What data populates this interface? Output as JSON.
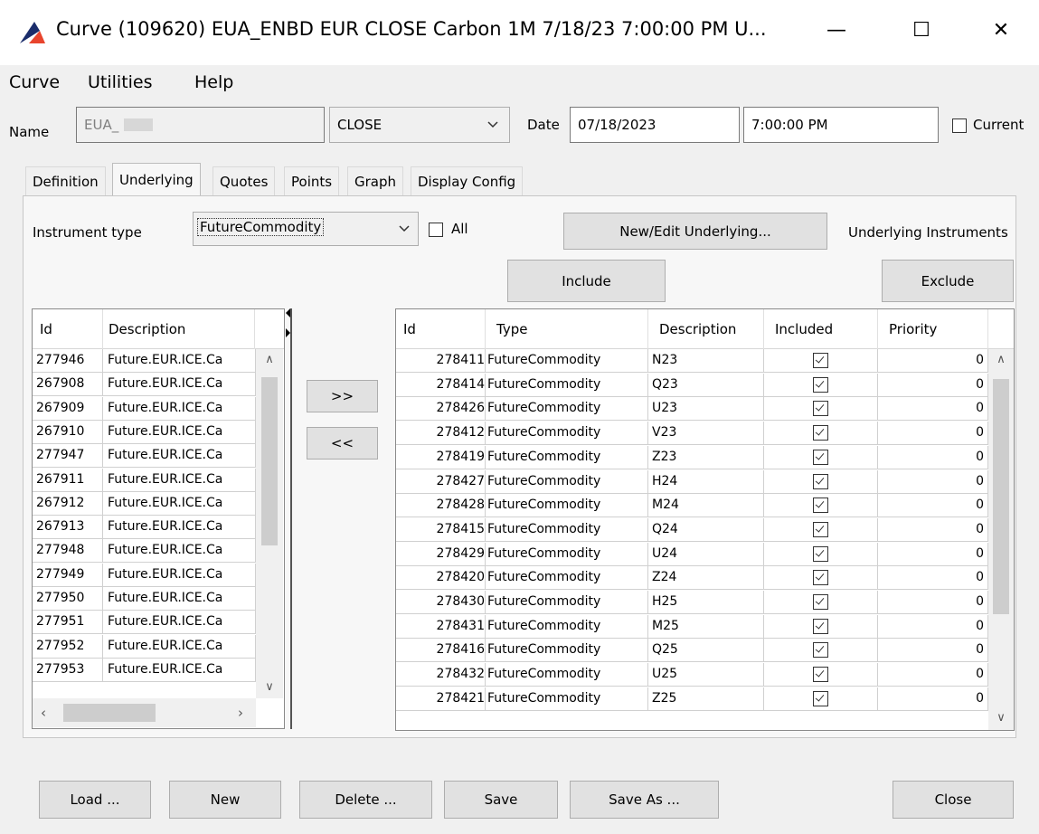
{
  "window": {
    "title": "Curve (109620) EUA_ENBD EUR CLOSE Carbon 1M 7/18/23 7:00:00 PM U...",
    "minimize": "—",
    "maximize": "☐",
    "close": "✕"
  },
  "menu": [
    "Curve",
    "Utilities",
    "Help"
  ],
  "header": {
    "name_label": "Name",
    "name_value": "EUA_",
    "price_type": "CLOSE",
    "date_label": "Date",
    "date_value": "07/18/2023",
    "time_value": "7:00:00 PM",
    "current_label": "Current"
  },
  "tabs": [
    "Definition",
    "Underlying",
    "Quotes",
    "Points",
    "Graph",
    "Display Config"
  ],
  "underlying": {
    "instrument_type_label": "Instrument type",
    "instrument_type_value": "FutureCommodity",
    "all_label": "All",
    "new_edit_button": "New/Edit Underlying...",
    "underlying_instruments_label": "Underlying Instruments",
    "include_button": "Include",
    "exclude_button": "Exclude",
    "move_right": ">>",
    "move_left": "<<"
  },
  "left_table": {
    "columns": [
      "Id",
      "Description"
    ],
    "rows": [
      [
        "277946",
        "Future.EUR.ICE.Ca"
      ],
      [
        "267908",
        "Future.EUR.ICE.Ca"
      ],
      [
        "267909",
        "Future.EUR.ICE.Ca"
      ],
      [
        "267910",
        "Future.EUR.ICE.Ca"
      ],
      [
        "277947",
        "Future.EUR.ICE.Ca"
      ],
      [
        "267911",
        "Future.EUR.ICE.Ca"
      ],
      [
        "267912",
        "Future.EUR.ICE.Ca"
      ],
      [
        "267913",
        "Future.EUR.ICE.Ca"
      ],
      [
        "277948",
        "Future.EUR.ICE.Ca"
      ],
      [
        "277949",
        "Future.EUR.ICE.Ca"
      ],
      [
        "277950",
        "Future.EUR.ICE.Ca"
      ],
      [
        "277951",
        "Future.EUR.ICE.Ca"
      ],
      [
        "277952",
        "Future.EUR.ICE.Ca"
      ],
      [
        "277953",
        "Future.EUR.ICE.Ca"
      ]
    ]
  },
  "right_table": {
    "columns": [
      "Id",
      "Type",
      "Description",
      "Included",
      "Priority"
    ],
    "rows": [
      [
        "278411",
        "FutureCommodity",
        "N23",
        true,
        "0"
      ],
      [
        "278414",
        "FutureCommodity",
        "Q23",
        true,
        "0"
      ],
      [
        "278426",
        "FutureCommodity",
        "U23",
        true,
        "0"
      ],
      [
        "278412",
        "FutureCommodity",
        "V23",
        true,
        "0"
      ],
      [
        "278419",
        "FutureCommodity",
        "Z23",
        true,
        "0"
      ],
      [
        "278427",
        "FutureCommodity",
        "H24",
        true,
        "0"
      ],
      [
        "278428",
        "FutureCommodity",
        "M24",
        true,
        "0"
      ],
      [
        "278415",
        "FutureCommodity",
        "Q24",
        true,
        "0"
      ],
      [
        "278429",
        "FutureCommodity",
        "U24",
        true,
        "0"
      ],
      [
        "278420",
        "FutureCommodity",
        "Z24",
        true,
        "0"
      ],
      [
        "278430",
        "FutureCommodity",
        "H25",
        true,
        "0"
      ],
      [
        "278431",
        "FutureCommodity",
        "M25",
        true,
        "0"
      ],
      [
        "278416",
        "FutureCommodity",
        "Q25",
        true,
        "0"
      ],
      [
        "278432",
        "FutureCommodity",
        "U25",
        true,
        "0"
      ],
      [
        "278421",
        "FutureCommodity",
        "Z25",
        true,
        "0"
      ]
    ]
  },
  "footer": {
    "load": "Load ...",
    "new": "New",
    "delete": "Delete ...",
    "save": "Save",
    "save_as": "Save As ...",
    "close": "Close"
  }
}
